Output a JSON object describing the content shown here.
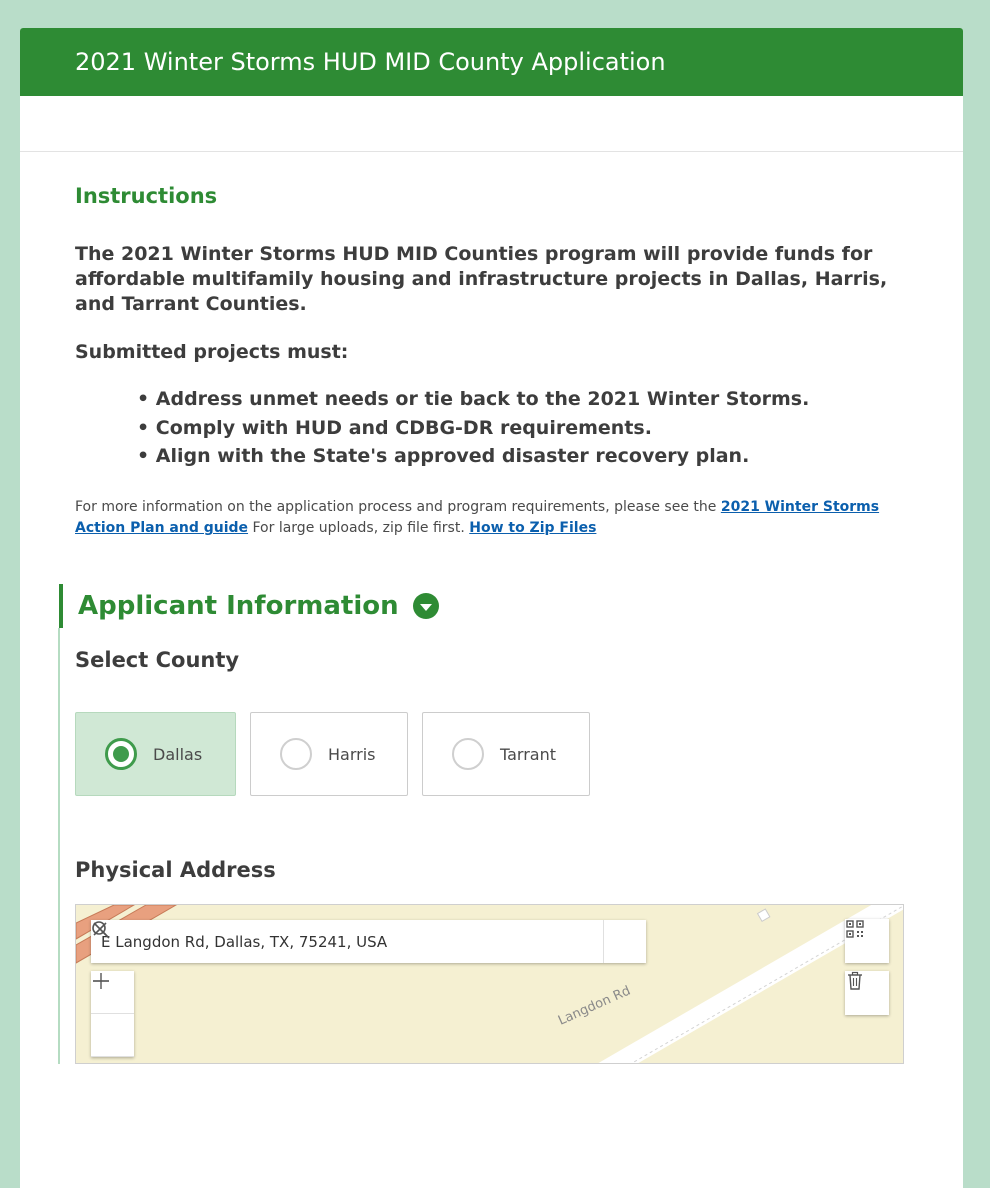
{
  "header": {
    "title": "2021 Winter Storms HUD MID County Application"
  },
  "instructions": {
    "title": "Instructions",
    "lead": "The 2021 Winter Storms HUD MID Counties program will provide funds for affordable multifamily housing and infrastructure projects in Dallas, Harris, and Tarrant Counties.",
    "subtitle": "Submitted projects must:",
    "bullets": [
      "Address unmet needs or tie back to the 2021 Winter Storms.",
      "Comply with HUD and CDBG-DR requirements.",
      "Align with the State's approved disaster recovery plan."
    ],
    "info_text_1": "For more information on the application process and program requirements, please see the ",
    "link_action_plan": "2021 Winter Storms Action Plan and guide",
    "info_text_2": " For large uploads, zip file first. ",
    "link_zip": "How to Zip Files"
  },
  "applicant": {
    "section_title": "Applicant Information",
    "county_label": "Select County",
    "county_options": [
      "Dallas",
      "Harris",
      "Tarrant"
    ],
    "selected_county": "Dallas",
    "address_label": "Physical Address",
    "address_value": "E Langdon Rd, Dallas, TX, 75241, USA",
    "map_road_label": "Langdon Rd"
  },
  "icons": {
    "collapse": "chevron-down-icon",
    "clear": "close-icon",
    "search": "search-icon",
    "qr": "qr-code-icon",
    "delete": "trash-icon",
    "zoom_in": "plus-icon",
    "zoom_out": "minus-icon"
  },
  "colors": {
    "brand": "#2e8b34",
    "page_bg": "#b9ddc9",
    "selected_bg": "#d0e8d5",
    "link": "#0b5fad"
  }
}
